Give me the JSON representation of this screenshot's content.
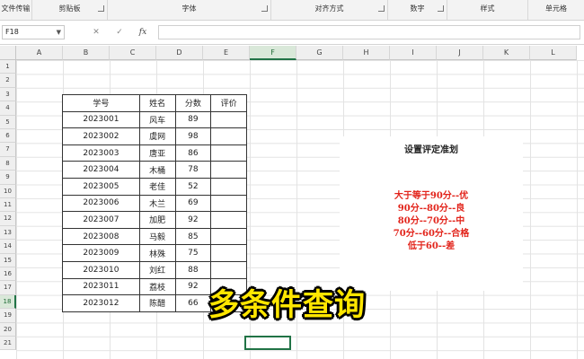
{
  "ribbon": {
    "groups": [
      "文件传输",
      "剪贴板",
      "字体",
      "对齐方式",
      "数字",
      "样式",
      "单元格"
    ]
  },
  "formula_bar": {
    "name_box": "F18",
    "cancel_glyph": "✕",
    "enter_glyph": "✓",
    "fx_label": "fx",
    "formula": ""
  },
  "columns": [
    "A",
    "B",
    "C",
    "D",
    "E",
    "F",
    "G",
    "H",
    "I",
    "J",
    "K",
    "L"
  ],
  "active_column": "F",
  "rows": [
    "1",
    "2",
    "3",
    "4",
    "5",
    "6",
    "7",
    "8",
    "9",
    "10",
    "11",
    "12",
    "13",
    "14",
    "15",
    "16",
    "17",
    "18",
    "19",
    "20",
    "21"
  ],
  "active_row": "18",
  "table": {
    "headers": [
      "学号",
      "姓名",
      "分数",
      "评价"
    ],
    "rows": [
      [
        "2023001",
        "风车",
        "89",
        ""
      ],
      [
        "2023002",
        "虞网",
        "98",
        ""
      ],
      [
        "2023003",
        "唐亚",
        "86",
        ""
      ],
      [
        "2023004",
        "木桶",
        "78",
        ""
      ],
      [
        "2023005",
        "老佳",
        "52",
        ""
      ],
      [
        "2023006",
        "木兰",
        "69",
        ""
      ],
      [
        "2023007",
        "加肥",
        "92",
        ""
      ],
      [
        "2023008",
        "马毅",
        "85",
        ""
      ],
      [
        "2023009",
        "林殊",
        "75",
        ""
      ],
      [
        "2023010",
        "刘红",
        "88",
        ""
      ],
      [
        "2023011",
        "荔枝",
        "92",
        ""
      ],
      [
        "2023012",
        "陈醋",
        "66",
        ""
      ]
    ]
  },
  "criteria": {
    "title": "设置评定准划",
    "rules": [
      "大于等于90分--优",
      "90分--80分--良",
      "80分--70分--中",
      "70分--60分--合格",
      "低于60--差"
    ],
    "rule_color": "#e2231a"
  },
  "overlay": {
    "caption": "多条件查询",
    "caption_color": "#ffe600"
  },
  "accent_color": "#217346"
}
